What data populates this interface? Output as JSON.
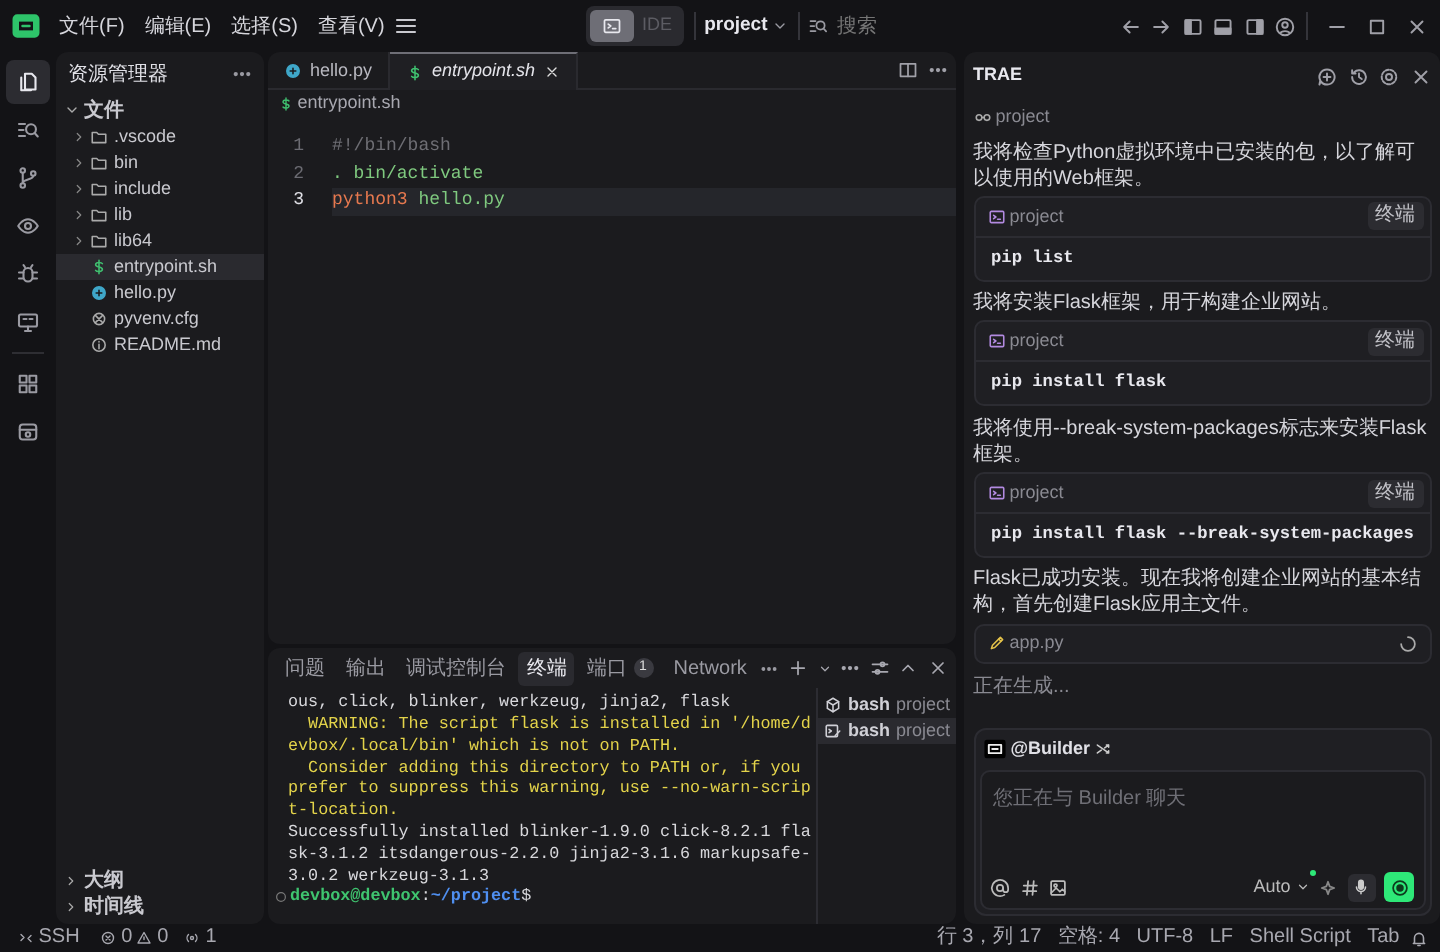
{
  "title_bar": {
    "menus": [
      "文件(F)",
      "编辑(E)",
      "选择(S)",
      "查看(V)"
    ],
    "mode_toggle": [
      {
        "kind": "icon",
        "selected": true
      },
      {
        "kind": "text",
        "label": "IDE",
        "selected": false
      }
    ],
    "project": "project",
    "search": {
      "placeholder": "搜索"
    }
  },
  "activity_bar": [
    {
      "kind": "explorer",
      "selected": true
    },
    {
      "kind": "search",
      "selected": false
    },
    {
      "kind": "source-control",
      "selected": false
    },
    {
      "kind": "preview",
      "selected": false
    },
    {
      "kind": "debug",
      "selected": false
    },
    {
      "kind": "remote",
      "selected": false
    },
    {
      "kind": "extensions",
      "selected": false
    },
    {
      "kind": "database",
      "selected": false
    }
  ],
  "explorer": {
    "title": "资源管理器",
    "root": {
      "label": "文件",
      "expanded": true,
      "children": [
        {
          "label": ".vscode",
          "kind": "folder",
          "expanded": false,
          "selected": false
        },
        {
          "label": "bin",
          "kind": "folder",
          "expanded": false,
          "selected": false
        },
        {
          "label": "include",
          "kind": "folder",
          "expanded": false,
          "selected": false
        },
        {
          "label": "lib",
          "kind": "folder",
          "expanded": false,
          "selected": false
        },
        {
          "label": "lib64",
          "kind": "folder",
          "expanded": false,
          "selected": false
        },
        {
          "label": "entrypoint.sh",
          "kind": "shell",
          "selected": true
        },
        {
          "label": "hello.py",
          "kind": "python",
          "selected": false
        },
        {
          "label": "pyvenv.cfg",
          "kind": "config",
          "selected": false
        },
        {
          "label": "README.md",
          "kind": "info",
          "selected": false
        }
      ]
    },
    "sections": [
      {
        "label": "大纲",
        "expanded": false
      },
      {
        "label": "时间线",
        "expanded": false
      }
    ]
  },
  "editor": {
    "tabs": [
      {
        "label": "hello.py",
        "kind": "python",
        "selected": false
      },
      {
        "label": "entrypoint.sh",
        "kind": "shell",
        "selected": true
      }
    ],
    "breadcrumb": {
      "label": "entrypoint.sh",
      "kind": "shell"
    },
    "lines": [
      {
        "number": "1",
        "current": false,
        "tokens": [
          {
            "text": "#!/bin/bash",
            "kind": "comment"
          }
        ]
      },
      {
        "number": "2",
        "current": false,
        "tokens": [
          {
            "text": ". bin/activate",
            "kind": "string"
          }
        ]
      },
      {
        "number": "3",
        "current": true,
        "tokens": [
          {
            "text": "python3",
            "kind": "command"
          },
          {
            "text": " hello.py",
            "kind": "string"
          }
        ]
      }
    ]
  },
  "panel": {
    "tabs": [
      {
        "label": "问题",
        "selected": false
      },
      {
        "label": "输出",
        "selected": false
      },
      {
        "label": "调试控制台",
        "selected": false
      },
      {
        "label": "终端",
        "selected": true
      },
      {
        "label": "端口",
        "badge": "1",
        "selected": false
      },
      {
        "label": "Network",
        "selected": false
      }
    ],
    "terminal_lines": [
      {
        "text": "ous, click, blinker, werkzeug, jinja2, flask",
        "kind": "normal"
      },
      {
        "text": "  WARNING: The script flask is installed in '/home/d",
        "kind": "warning"
      },
      {
        "text": "evbox/.local/bin' which is not on PATH.",
        "kind": "warning"
      },
      {
        "text": "  Consider adding this directory to PATH or, if you",
        "kind": "warning"
      },
      {
        "text": "prefer to suppress this warning, use --no-warn-scrip",
        "kind": "warning"
      },
      {
        "text": "t-location.",
        "kind": "warning"
      },
      {
        "text": "Successfully installed blinker-1.9.0 click-8.2.1 fla",
        "kind": "normal"
      },
      {
        "text": "sk-3.1.2 itsdangerous-2.2.0 jinja2-3.1.6 markupsafe-",
        "kind": "normal"
      },
      {
        "text": "3.0.2 werkzeug-3.1.3",
        "kind": "normal"
      }
    ],
    "prompt": {
      "user": "devbox@devbox",
      "separator": ":",
      "path": "~/project",
      "symbol": "$"
    },
    "sessions": [
      {
        "name": "bash",
        "project": "project",
        "kind": "cube",
        "selected": false
      },
      {
        "name": "bash",
        "project": "project",
        "kind": "terminal",
        "selected": true
      }
    ]
  },
  "chat": {
    "title": "TRAE",
    "context": "project",
    "messages": [
      {
        "kind": "text",
        "text": "我将检查Python虚拟环境中已安装的包，以了解可以使用的Web框架。"
      },
      {
        "kind": "command",
        "project": "project",
        "button": "终端",
        "command": "pip list"
      },
      {
        "kind": "text",
        "text": "我将安装Flask框架，用于构建企业网站。"
      },
      {
        "kind": "command",
        "project": "project",
        "button": "终端",
        "command": "pip install flask"
      },
      {
        "kind": "text",
        "text": "我将使用--break-system-packages标志来安装Flask框架。"
      },
      {
        "kind": "command",
        "project": "project",
        "button": "终端",
        "command": "pip install flask --break-system-packages"
      },
      {
        "kind": "text",
        "text": "Flask已成功安装。现在我将创建企业网站的基本结构，首先创建Flask应用主文件。"
      },
      {
        "kind": "file",
        "name": "app.py",
        "loading": true
      }
    ],
    "status": "正在生成...",
    "composer": {
      "agent": "@Builder",
      "placeholder": "您正在与 Builder 聊天",
      "model": "Auto"
    }
  },
  "status_bar": {
    "remote": "SSH",
    "errors": "0",
    "warnings": "0",
    "ports": "1",
    "items": [
      "行 3，列 17",
      "空格: 4",
      "UTF-8",
      "LF",
      "Shell Script",
      "Tab"
    ]
  }
}
